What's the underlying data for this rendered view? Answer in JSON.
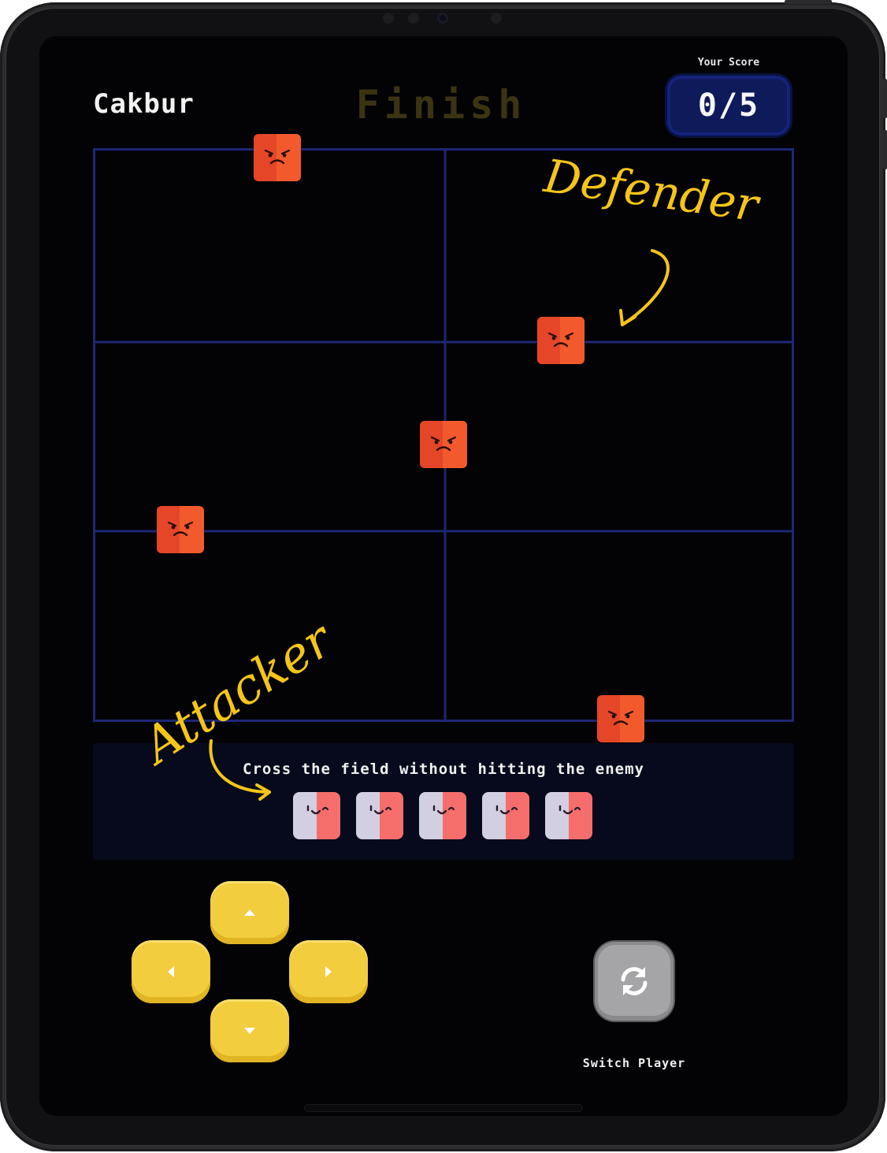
{
  "header": {
    "player_name": "Cakbur",
    "finish_label": "Finish",
    "score_label": "Your Score",
    "score_value": "0/5"
  },
  "field": {
    "columns": 2,
    "rows": 3,
    "enemies": [
      {
        "name": "enemy",
        "icon": "angry-face-icon"
      },
      {
        "name": "enemy",
        "icon": "angry-face-icon"
      },
      {
        "name": "enemy",
        "icon": "angry-face-icon"
      },
      {
        "name": "enemy",
        "icon": "angry-face-icon"
      },
      {
        "name": "enemy",
        "icon": "angry-face-icon"
      }
    ]
  },
  "info_panel": {
    "instruction": "Cross the field without hitting the enemy",
    "lives_count": 5,
    "life_icon": "smiling-face-icon"
  },
  "controls": {
    "up_icon": "arrow-up-icon",
    "left_icon": "arrow-left-icon",
    "right_icon": "arrow-right-icon",
    "down_icon": "arrow-down-icon",
    "switch_icon": "refresh-icon",
    "switch_label": "Switch Player"
  },
  "annotations": {
    "defender": "Defender",
    "attacker": "Attacker"
  },
  "colors": {
    "screen_bg": "#030305",
    "grid_line": "#1d2775",
    "enemy": "#f25a2d",
    "score_box": "#0e1a5a",
    "dpad": "#f2cd3e",
    "switch_button": "#a5a5a7",
    "annotation": "#f5c518",
    "finish_text": "#3b3413"
  }
}
